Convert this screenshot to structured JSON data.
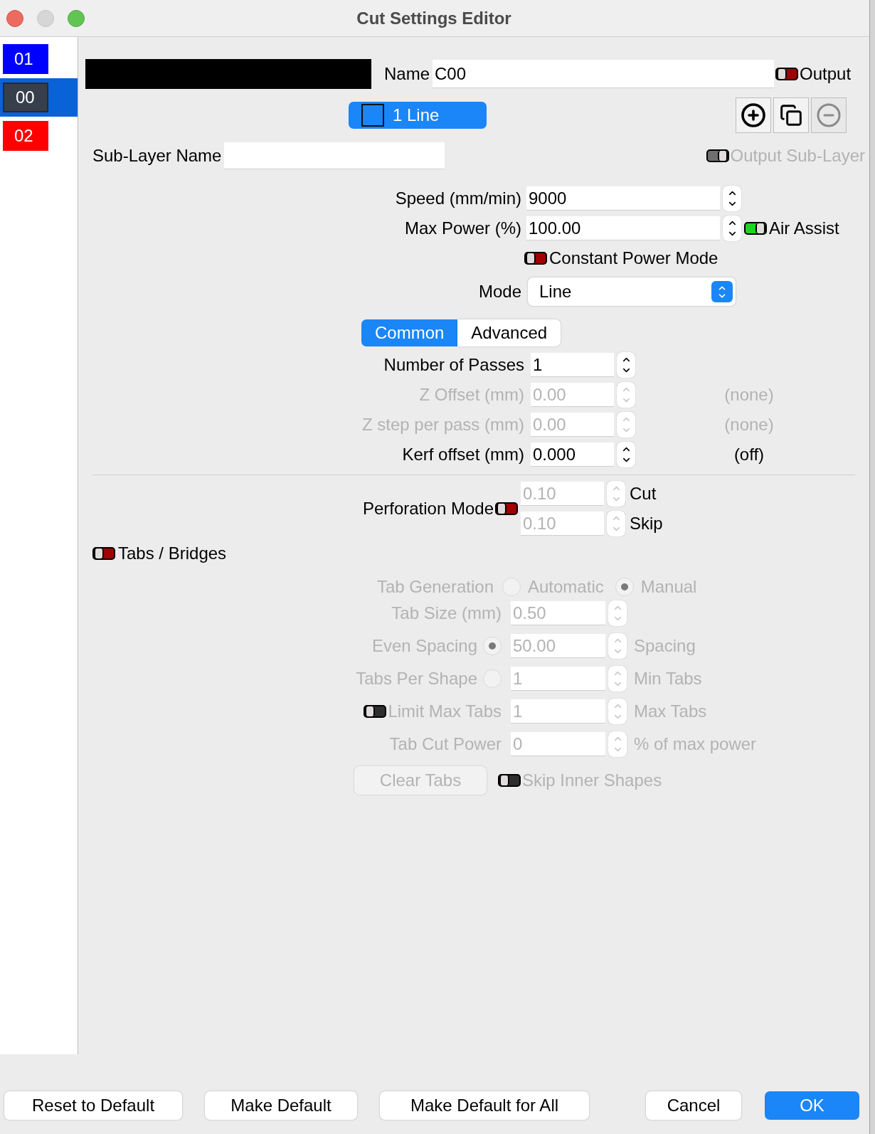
{
  "window": {
    "title": "Cut Settings Editor"
  },
  "layers": [
    {
      "label": "01",
      "color": "#0000ff",
      "selected": false
    },
    {
      "label": "00",
      "color": "#373f4c",
      "selected": true
    },
    {
      "label": "02",
      "color": "#ff0000",
      "selected": false
    }
  ],
  "name_row": {
    "label": "Name",
    "value": "C00",
    "output": {
      "label": "Output",
      "on": false
    }
  },
  "sub_layer_button": {
    "label": "1 Line"
  },
  "icon_buttons": [
    {
      "kind": "add",
      "disabled": false
    },
    {
      "kind": "copy",
      "disabled": false
    },
    {
      "kind": "remove",
      "disabled": true
    }
  ],
  "sub_layer": {
    "label": "Sub-Layer Name",
    "output": {
      "label": "Output Sub-Layer",
      "on": true,
      "disabled": true
    }
  },
  "power_fields": [
    {
      "label": "Speed (mm/min)",
      "value": "9000"
    },
    {
      "label": "Max Power (%)",
      "value": "100.00",
      "toggle": {
        "label": "Air Assist",
        "on": true
      }
    }
  ],
  "constant_power": {
    "label": "Constant Power Mode",
    "on": false
  },
  "mode": {
    "label": "Mode",
    "value": "Line"
  },
  "tabs": [
    {
      "label": "Common",
      "selected": true
    },
    {
      "label": "Advanced",
      "selected": false
    }
  ],
  "common_fields": [
    {
      "label": "Number of Passes",
      "value": "1",
      "disabled": false
    },
    {
      "label": "Z Offset (mm)",
      "value": "0.00",
      "disabled": true,
      "note": "(none)"
    },
    {
      "label": "Z step per pass (mm)",
      "value": "0.00",
      "disabled": true,
      "note": "(none)"
    },
    {
      "label": "Kerf offset (mm)",
      "value": "0.000",
      "disabled": false,
      "note": "(off)"
    }
  ],
  "perforation": {
    "label": "Perforation Mode",
    "on": false,
    "fields": [
      {
        "value": "0.10",
        "label": "Cut",
        "disabled": true
      },
      {
        "value": "0.10",
        "label": "Skip",
        "disabled": true
      }
    ]
  },
  "tabs_bridges": {
    "label": "Tabs / Bridges",
    "on": false
  },
  "tab_generation": {
    "label": "Tab Generation",
    "disabled": true,
    "options": [
      {
        "label": "Automatic",
        "selected": false
      },
      {
        "label": "Manual",
        "selected": true
      }
    ]
  },
  "tab_rows": [
    {
      "kind": "field",
      "label": "Tab Size (mm)",
      "value": "0.50",
      "disabled": true
    },
    {
      "kind": "radio",
      "label": "Even Spacing",
      "selected": true,
      "value": "50.00",
      "unit": "Spacing",
      "disabled": true
    },
    {
      "kind": "radio",
      "label": "Tabs Per Shape",
      "selected": false,
      "value": "1",
      "unit": "Min Tabs",
      "disabled": true
    },
    {
      "kind": "toggle",
      "label": "Limit Max Tabs",
      "on": false,
      "value": "1",
      "unit": "Max Tabs",
      "disabled": true
    },
    {
      "kind": "field",
      "label": "Tab Cut Power",
      "value": "0",
      "unit": "% of max power",
      "disabled": true
    }
  ],
  "clear_tabs": {
    "label": "Clear Tabs",
    "disabled": true
  },
  "skip_inner": {
    "label": "Skip Inner Shapes",
    "on": false,
    "disabled": true
  },
  "footer_buttons": [
    {
      "label": "Reset to Default",
      "kind": "normal"
    },
    {
      "label": "Make Default",
      "kind": "normal"
    },
    {
      "label": "Make Default for All",
      "kind": "normal"
    },
    {
      "label": "Cancel",
      "kind": "normal"
    },
    {
      "label": "OK",
      "kind": "default"
    }
  ]
}
